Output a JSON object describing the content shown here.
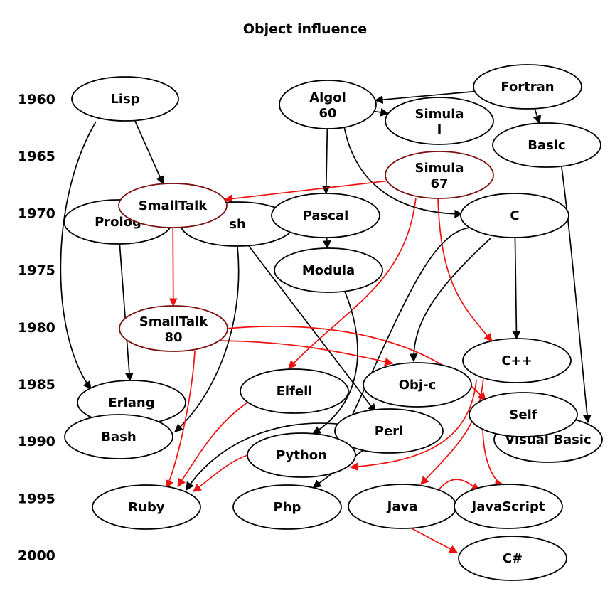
{
  "title": "Object influence",
  "colors": {
    "influence_black": "#000000",
    "oo_influence_red": "#ee1111",
    "oo_node_border": "#7a1010"
  },
  "years": [
    "1960",
    "1965",
    "1970",
    "1975",
    "1980",
    "1985",
    "1990",
    "1995",
    "2000"
  ],
  "nodes": [
    {
      "id": "lisp",
      "label": [
        "Lisp"
      ],
      "kind": "normal"
    },
    {
      "id": "algol",
      "label": [
        "Algol",
        "60"
      ],
      "kind": "normal"
    },
    {
      "id": "fortran",
      "label": [
        "Fortran"
      ],
      "kind": "normal"
    },
    {
      "id": "simula1",
      "label": [
        "Simula",
        "I"
      ],
      "kind": "normal"
    },
    {
      "id": "basic",
      "label": [
        "Basic"
      ],
      "kind": "normal"
    },
    {
      "id": "simula67",
      "label": [
        "Simula",
        "67"
      ],
      "kind": "oo"
    },
    {
      "id": "prolog",
      "label": [
        "Prolog"
      ],
      "kind": "normal"
    },
    {
      "id": "sh",
      "label": [
        "sh"
      ],
      "kind": "normal"
    },
    {
      "id": "smalltalk",
      "label": [
        "SmallTalk"
      ],
      "kind": "oo"
    },
    {
      "id": "pascal",
      "label": [
        "Pascal"
      ],
      "kind": "normal"
    },
    {
      "id": "c",
      "label": [
        "C"
      ],
      "kind": "normal"
    },
    {
      "id": "modula",
      "label": [
        "Modula"
      ],
      "kind": "normal"
    },
    {
      "id": "smalltalk80",
      "label": [
        "SmallTalk",
        "80"
      ],
      "kind": "oo"
    },
    {
      "id": "cpp",
      "label": [
        "C++"
      ],
      "kind": "normal"
    },
    {
      "id": "eiffel",
      "label": [
        "Eifell"
      ],
      "kind": "normal"
    },
    {
      "id": "objc",
      "label": [
        "Obj-c"
      ],
      "kind": "normal"
    },
    {
      "id": "erlang",
      "label": [
        "Erlang"
      ],
      "kind": "normal"
    },
    {
      "id": "visualbasic",
      "label": [
        "Visual Basic"
      ],
      "kind": "normal"
    },
    {
      "id": "self",
      "label": [
        "Self"
      ],
      "kind": "normal"
    },
    {
      "id": "bash",
      "label": [
        "Bash"
      ],
      "kind": "normal"
    },
    {
      "id": "perl",
      "label": [
        "Perl"
      ],
      "kind": "normal"
    },
    {
      "id": "python",
      "label": [
        "Python"
      ],
      "kind": "normal"
    },
    {
      "id": "ruby",
      "label": [
        "Ruby"
      ],
      "kind": "normal"
    },
    {
      "id": "php",
      "label": [
        "Php"
      ],
      "kind": "normal"
    },
    {
      "id": "java",
      "label": [
        "Java"
      ],
      "kind": "normal"
    },
    {
      "id": "javascript",
      "label": [
        "JavaScript"
      ],
      "kind": "normal"
    },
    {
      "id": "csharp",
      "label": [
        "C#"
      ],
      "kind": "normal"
    }
  ],
  "edges": [
    {
      "from": "fortran",
      "to": "algol",
      "type": "black"
    },
    {
      "from": "fortran",
      "to": "basic",
      "type": "black"
    },
    {
      "from": "algol",
      "to": "simula1",
      "type": "black"
    },
    {
      "from": "algol",
      "to": "pascal",
      "type": "black"
    },
    {
      "from": "algol",
      "to": "c",
      "type": "black"
    },
    {
      "from": "lisp",
      "to": "smalltalk",
      "type": "black"
    },
    {
      "from": "lisp",
      "to": "erlang",
      "type": "black"
    },
    {
      "from": "simula67",
      "to": "smalltalk",
      "type": "red"
    },
    {
      "from": "simula67",
      "to": "eiffel",
      "type": "red"
    },
    {
      "from": "simula67",
      "to": "cpp",
      "type": "red"
    },
    {
      "from": "pascal",
      "to": "modula",
      "type": "black"
    },
    {
      "from": "prolog",
      "to": "erlang",
      "type": "black"
    },
    {
      "from": "sh",
      "to": "bash",
      "type": "black"
    },
    {
      "from": "sh",
      "to": "perl",
      "type": "black"
    },
    {
      "from": "smalltalk",
      "to": "smalltalk80",
      "type": "red"
    },
    {
      "from": "c",
      "to": "cpp",
      "type": "black"
    },
    {
      "from": "c",
      "to": "objc",
      "type": "black"
    },
    {
      "from": "c",
      "to": "python",
      "type": "black"
    },
    {
      "from": "modula",
      "to": "python",
      "type": "black"
    },
    {
      "from": "basic",
      "to": "visualbasic",
      "type": "black"
    },
    {
      "from": "smalltalk80",
      "to": "objc",
      "type": "red"
    },
    {
      "from": "smalltalk80",
      "to": "self",
      "type": "red"
    },
    {
      "from": "smalltalk80",
      "to": "ruby",
      "type": "red"
    },
    {
      "from": "cpp",
      "to": "java",
      "type": "red"
    },
    {
      "from": "cpp",
      "to": "python",
      "type": "red"
    },
    {
      "from": "eiffel",
      "to": "ruby",
      "type": "red"
    },
    {
      "from": "perl",
      "to": "ruby",
      "type": "black"
    },
    {
      "from": "perl",
      "to": "php",
      "type": "black"
    },
    {
      "from": "python",
      "to": "ruby",
      "type": "red"
    },
    {
      "from": "self",
      "to": "javascript",
      "type": "red"
    },
    {
      "from": "java",
      "to": "javascript",
      "type": "red"
    },
    {
      "from": "java",
      "to": "csharp",
      "type": "red"
    }
  ]
}
